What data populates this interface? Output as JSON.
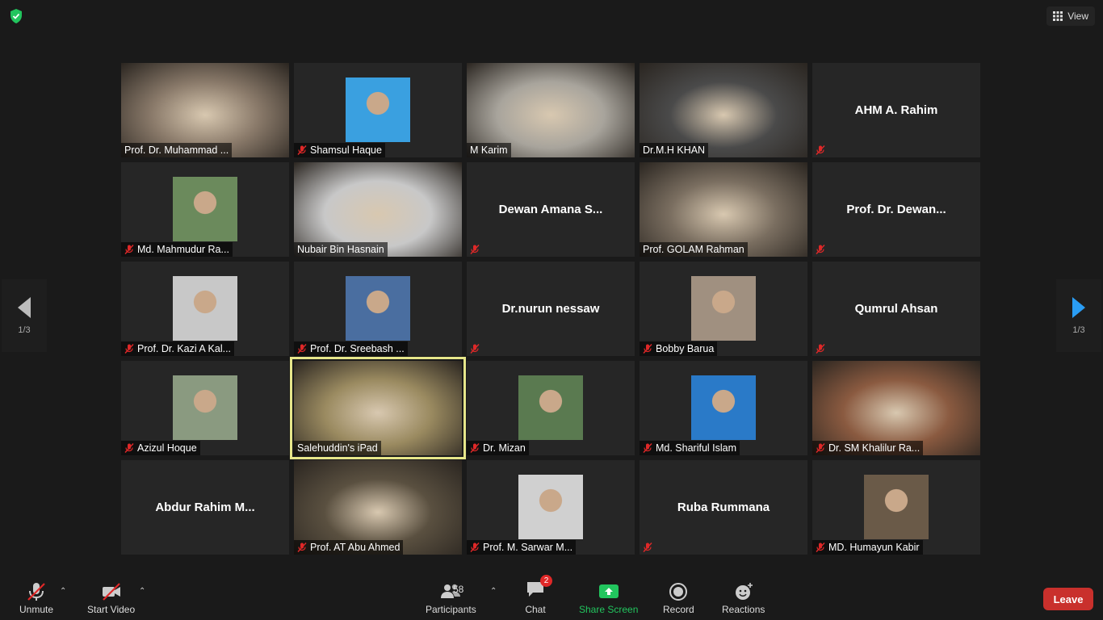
{
  "header": {
    "view_label": "View"
  },
  "pager": {
    "left_page": "1/3",
    "right_page": "1/3"
  },
  "tiles": [
    {
      "name": "Prof. Dr. Muhammad ...",
      "type": "video",
      "muted": false,
      "bg": "#8a7a6a"
    },
    {
      "name": "Shamsul Haque",
      "type": "photo",
      "muted": true,
      "bg": "#3aa0e0"
    },
    {
      "name": "M Karim",
      "type": "video",
      "muted": false,
      "bg": "#a8a49c"
    },
    {
      "name": "Dr.M.H KHAN",
      "type": "video",
      "muted": false,
      "bg": "#4a4a4a"
    },
    {
      "name": "AHM A. Rahim",
      "type": "name",
      "muted": true
    },
    {
      "name": "Md. Mahmudur Ra...",
      "type": "photo",
      "muted": true,
      "bg": "#6b8a5c"
    },
    {
      "name": "Nubair Bin Hasnain",
      "type": "video",
      "muted": false,
      "bg": "#c8c8c8"
    },
    {
      "name": "Dewan Amana S...",
      "type": "name",
      "muted": true
    },
    {
      "name": "Prof. GOLAM Rahman",
      "type": "video",
      "muted": false,
      "bg": "#7a6e60"
    },
    {
      "name": "Prof. Dr. Dewan...",
      "type": "name",
      "muted": true
    },
    {
      "name": "Prof. Dr. Kazi A Kal...",
      "type": "photo",
      "muted": true,
      "bg": "#c8c8c8"
    },
    {
      "name": "Prof. Dr. Sreebash ...",
      "type": "photo",
      "muted": true,
      "bg": "#4a6ea0"
    },
    {
      "name": "Dr.nurun nessaw",
      "type": "name",
      "muted": true
    },
    {
      "name": "Bobby Barua",
      "type": "photo",
      "muted": true,
      "bg": "#a09080"
    },
    {
      "name": "Qumrul Ahsan",
      "type": "name",
      "muted": true
    },
    {
      "name": "Azizul Hoque",
      "type": "photo",
      "muted": true,
      "bg": "#8a9a80"
    },
    {
      "name": "Salehuddin's iPad",
      "type": "video",
      "muted": false,
      "active": true,
      "bg": "#9a8a60"
    },
    {
      "name": "Dr. Mizan",
      "type": "photo",
      "muted": true,
      "bg": "#5a7a50"
    },
    {
      "name": "Md. Shariful Islam",
      "type": "photo",
      "muted": true,
      "bg": "#2a7ac8"
    },
    {
      "name": "Dr. SM Khalilur Ra...",
      "type": "video",
      "muted": true,
      "bg": "#8a5a40"
    },
    {
      "name": "Abdur Rahim M...",
      "type": "name",
      "muted": false
    },
    {
      "name": "Prof. AT Abu Ahmed",
      "type": "video",
      "muted": true,
      "bg": "#5a5040"
    },
    {
      "name": "Prof. M. Sarwar M...",
      "type": "photo",
      "muted": true,
      "bg": "#d0d0d0"
    },
    {
      "name": "Ruba Rummana",
      "type": "name",
      "muted": true
    },
    {
      "name": "MD. Humayun Kabir",
      "type": "photo",
      "muted": true,
      "bg": "#6a5a48"
    }
  ],
  "toolbar": {
    "unmute_label": "Unmute",
    "start_video_label": "Start Video",
    "participants_label": "Participants",
    "participants_count": "58",
    "chat_label": "Chat",
    "chat_badge": "2",
    "share_label": "Share Screen",
    "record_label": "Record",
    "reactions_label": "Reactions",
    "leave_label": "Leave"
  },
  "colors": {
    "share_green": "#22c55e",
    "leave_red": "#c9302c",
    "active_border": "#e6e68a",
    "muted_red": "#e02828"
  }
}
